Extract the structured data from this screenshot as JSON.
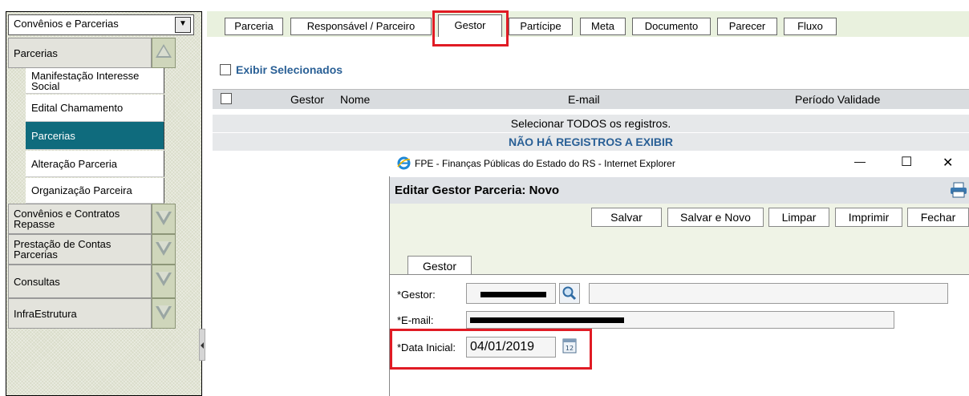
{
  "sidebar": {
    "module_select": "Convênios e Parcerias",
    "sections": [
      {
        "label": "Parcerias",
        "expanded": true
      },
      {
        "label": "Convênios e Contratos Repasse",
        "expanded": false
      },
      {
        "label": "Prestação de Contas Parcerias",
        "expanded": false
      },
      {
        "label": "Consultas",
        "expanded": false
      },
      {
        "label": "InfraEstrutura",
        "expanded": false
      }
    ],
    "items": [
      {
        "label": "Manifestação Interesse Social",
        "active": false
      },
      {
        "label": "Edital Chamamento",
        "active": false
      },
      {
        "label": "Parcerias",
        "active": true
      },
      {
        "label": "Alteração Parceria",
        "active": false
      },
      {
        "label": "Organização Parceira",
        "active": false
      }
    ]
  },
  "tabs": [
    "Parceria",
    "Responsável / Parceiro",
    "Gestor",
    "Partícipe",
    "Meta",
    "Documento",
    "Parecer",
    "Fluxo"
  ],
  "active_tab": "Gestor",
  "grid": {
    "show_selected_label": "Exibir Selecionados",
    "columns": [
      "Gestor",
      "Nome",
      "E-mail",
      "Período Validade"
    ],
    "select_all_text": "Selecionar TODOS os registros.",
    "empty_text": "NÃO HÁ REGISTROS A EXIBIR"
  },
  "popup": {
    "window_title": "FPE - Finanças Públicas do Estado do RS - Internet Explorer",
    "header": "Editar Gestor Parceria: Novo",
    "buttons": [
      "Salvar",
      "Salvar e Novo",
      "Limpar",
      "Imprimir",
      "Fechar"
    ],
    "tab": "Gestor",
    "fields": {
      "gestor_label": "*Gestor:",
      "email_label": "*E-mail:",
      "data_inicial_label": "*Data Inicial:",
      "data_inicial_value": "04/01/2019"
    },
    "window_controls": {
      "minimize": "—",
      "maximize": "☐",
      "close": "✕"
    }
  },
  "colors": {
    "accent_active": "#0f6b7d",
    "highlight": "#e01b24",
    "link_blue": "#2a6096"
  }
}
